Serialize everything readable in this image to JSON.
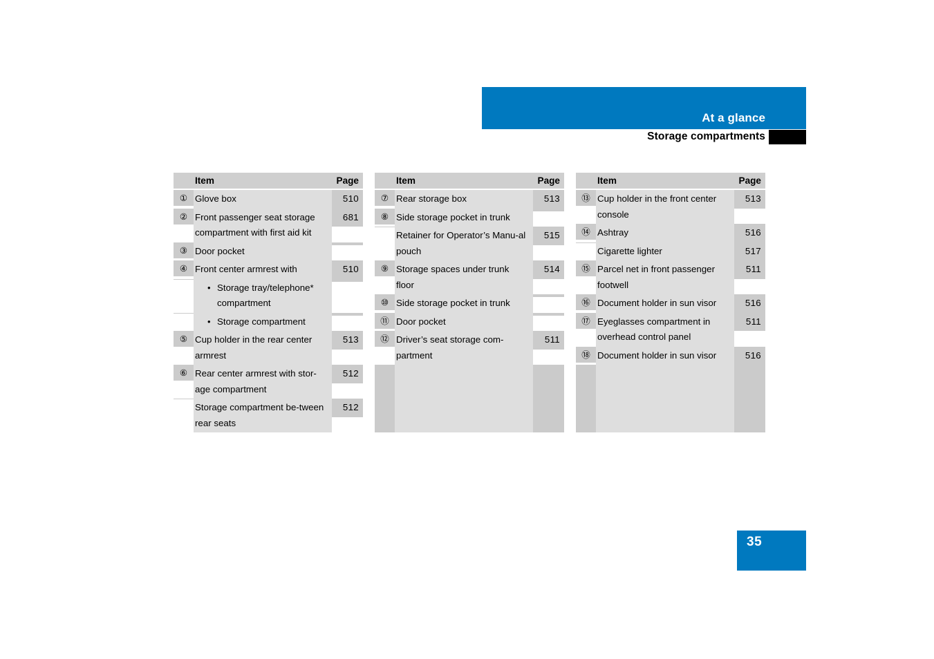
{
  "header": {
    "title": "At a glance",
    "subtitle": "Storage compartments",
    "band_color": "#0079bf",
    "tab_color": "#000000"
  },
  "footer": {
    "page_number": "35",
    "badge_color": "#0079bf"
  },
  "table_headers": {
    "item": "Item",
    "page": "Page"
  },
  "columns": [
    {
      "rows": [
        {
          "num": "①",
          "text": "Glove box",
          "page": "510",
          "bullet": false
        },
        {
          "num": "②",
          "text": "Front passenger seat storage compartment with first aid kit",
          "page": "681",
          "bullet": false
        },
        {
          "num": "③",
          "text": "Door pocket",
          "page": "",
          "bullet": false
        },
        {
          "num": "④",
          "text": "Front center armrest with",
          "page": "510",
          "bullet": false
        },
        {
          "num": "",
          "text": "Storage tray/telephone* compartment",
          "page": "",
          "bullet": true
        },
        {
          "num": "",
          "text": "Storage compartment",
          "page": "",
          "bullet": true
        },
        {
          "num": "⑤",
          "text": "Cup holder in the rear center armrest",
          "page": "513",
          "bullet": false
        },
        {
          "num": "⑥",
          "text": "Rear center armrest with stor-age compartment",
          "page": "512",
          "bullet": false
        },
        {
          "num": "",
          "text": "Storage compartment be-tween rear seats",
          "page": "512",
          "bullet": false
        }
      ]
    },
    {
      "rows": [
        {
          "num": "⑦",
          "text": "Rear storage box",
          "page": "513",
          "bullet": false
        },
        {
          "num": "⑧",
          "text": "Side storage pocket in trunk",
          "page": "",
          "bullet": false
        },
        {
          "num": "",
          "text": "Retainer for Operator’s Manu-al pouch",
          "page": "515",
          "bullet": false
        },
        {
          "num": "⑨",
          "text": "Storage spaces under trunk floor",
          "page": "514",
          "bullet": false
        },
        {
          "num": "⑩",
          "text": "Side storage pocket in trunk",
          "page": "",
          "bullet": false
        },
        {
          "num": "⑪",
          "text": "Door pocket",
          "page": "",
          "bullet": false
        },
        {
          "num": "⑫",
          "text": "Driver’s seat storage com-partment",
          "page": "511",
          "bullet": false
        }
      ]
    },
    {
      "rows": [
        {
          "num": "⑬",
          "text": "Cup holder in the front center console",
          "page": "513",
          "bullet": false
        },
        {
          "num": "⑭",
          "text": "Ashtray",
          "page": "516",
          "bullet": false
        },
        {
          "num": "",
          "text": "Cigarette lighter",
          "page": "517",
          "bullet": false
        },
        {
          "num": "⑮",
          "text": "Parcel net in front passenger footwell",
          "page": "511",
          "bullet": false
        },
        {
          "num": "⑯",
          "text": "Document holder in sun visor",
          "page": "516",
          "bullet": false
        },
        {
          "num": "⑰",
          "text": "Eyeglasses compartment in overhead control panel",
          "page": "511",
          "bullet": false
        },
        {
          "num": "⑱",
          "text": "Document holder in sun visor",
          "page": "516",
          "bullet": false
        }
      ]
    }
  ]
}
